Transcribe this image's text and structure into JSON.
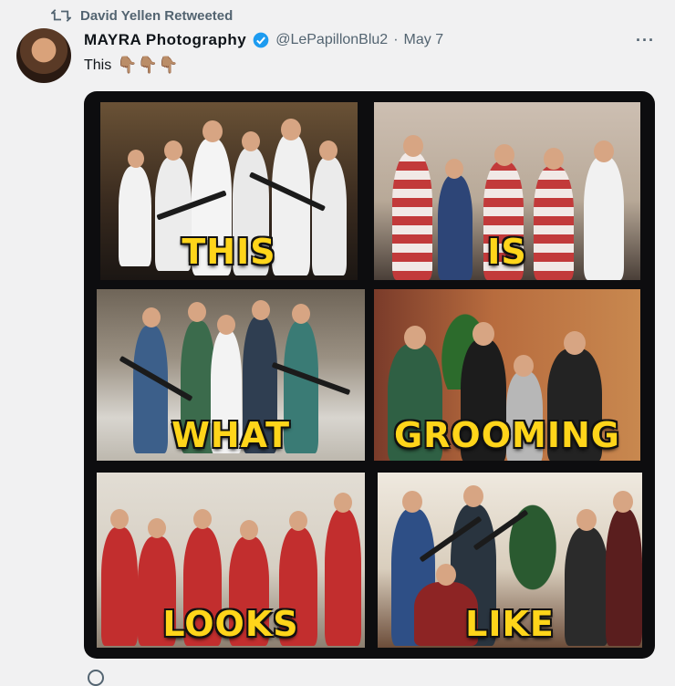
{
  "retweet": {
    "label": "David Yellen Retweeted",
    "icon": "retweet-icon"
  },
  "author": {
    "display_name": "MAYRA Photography",
    "verified_icon": "verified-badge-icon",
    "handle": "@LePapillonBlu2",
    "separator": "·",
    "date": "May 7"
  },
  "more_label": "···",
  "tweet": {
    "text": "This",
    "emoji": "👇🏽👇🏽👇🏽"
  },
  "media": {
    "panels": [
      {
        "word": "THIS"
      },
      {
        "word": "IS"
      },
      {
        "word": "WHAT"
      },
      {
        "word": "GROOMING"
      },
      {
        "word": "LOOKS"
      },
      {
        "word": "LIKE"
      }
    ]
  },
  "colors": {
    "accent": "#1d9bf0",
    "caption": "#ffd51a",
    "muted": "#536471"
  }
}
